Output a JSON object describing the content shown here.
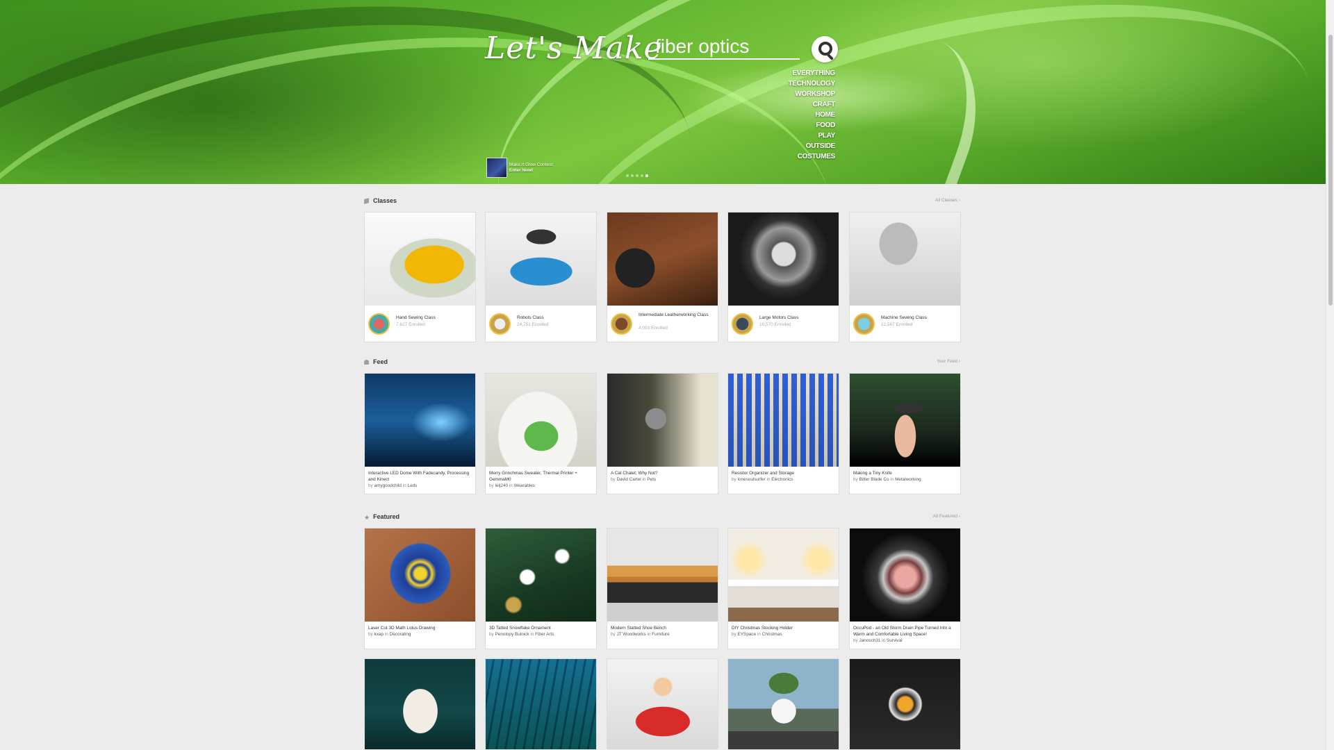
{
  "hero": {
    "brand": "Let's Make",
    "search_value": "fiber optics",
    "categories": [
      "Everything",
      "Technology",
      "Workshop",
      "Craft",
      "Home",
      "Food",
      "Play",
      "Outside",
      "Costumes"
    ],
    "contest_line1": "Make It Glow Contest:",
    "contest_line2": "Enter Now!"
  },
  "classes": {
    "title": "Classes",
    "more": "All Classes",
    "items": [
      {
        "title": "Hand Sewing Class",
        "enrolled": "7,627 Enrolled"
      },
      {
        "title": "Robots Class",
        "enrolled": "24,751 Enrolled"
      },
      {
        "title": "Intermediate Leatherworking Class",
        "enrolled": "4,003 Enrolled"
      },
      {
        "title": "Large Motors Class",
        "enrolled": "10,570 Enrolled"
      },
      {
        "title": "Machine Sewing Class",
        "enrolled": "12,567 Enrolled"
      }
    ]
  },
  "feed": {
    "title": "Feed",
    "more": "Your Feed",
    "items": [
      {
        "title": "Interactive LED Dome With Fadecandy, Processing and Kinect",
        "author": "amygoodchild",
        "category": "Leds"
      },
      {
        "title": "Merry Grinchmas Sweater, Thermal Printer + GemmaM0",
        "author": "lelj240",
        "category": "Wearables"
      },
      {
        "title": "A Cat Chalet; Why Not?",
        "author": "David Cartel",
        "category": "Pets"
      },
      {
        "title": "Resistor Organizer and Storage",
        "author": "lonesoulsurfer",
        "category": "Electronics"
      },
      {
        "title": "Making a Tiny Knife",
        "author": "Bitter Blade Co",
        "category": "Metalworking"
      }
    ]
  },
  "featured": {
    "title": "Featured",
    "more": "All Featured",
    "items": [
      {
        "title": "Laser Cut 3D Math Lotus Drawing",
        "author": "kxap",
        "category": "Decorating"
      },
      {
        "title": "3D Tatted Snowflake Ornament",
        "author": "Penolopy Bulnick",
        "category": "Fiber Arts"
      },
      {
        "title": "Modern Slatted Shoe Bench",
        "author": "JT Woodworks",
        "category": "Furniture"
      },
      {
        "title": "DIY Christmas Stocking Holder",
        "author": "EYSpace",
        "category": "Christmas"
      },
      {
        "title": "OccuPod - an Old Storm Drain Pipe Turned Into a Warm and Comfortable Living Space!",
        "author": "Janosch31",
        "category": "Survival"
      }
    ]
  },
  "labels": {
    "by": "by",
    "in": "in"
  }
}
